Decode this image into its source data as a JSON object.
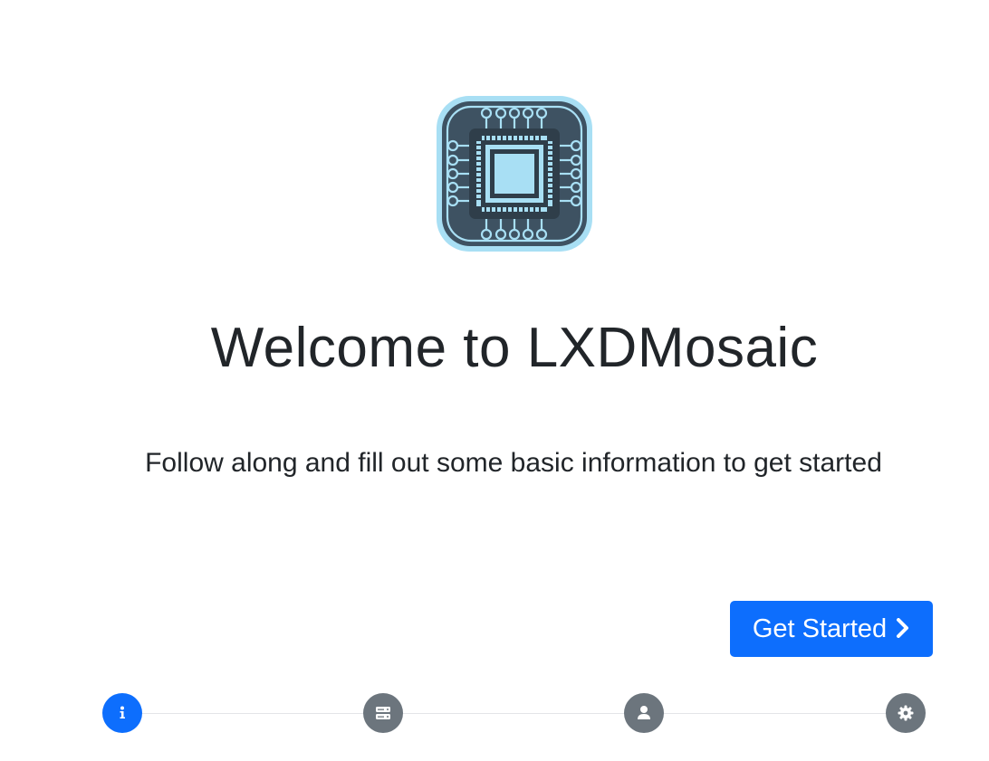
{
  "hero": {
    "logo_icon": "cpu-chip-icon",
    "title": "Welcome to LXDMosaic",
    "subtitle": "Follow along and fill out some basic information to get started"
  },
  "actions": {
    "get_started_label": "Get Started",
    "get_started_icon": "chevron-right-icon"
  },
  "stepper": {
    "current_step": 1,
    "steps": [
      {
        "icon": "info-icon",
        "state": "active"
      },
      {
        "icon": "server-icon",
        "state": "inactive"
      },
      {
        "icon": "user-icon",
        "state": "inactive"
      },
      {
        "icon": "gear-icon",
        "state": "inactive"
      }
    ]
  },
  "colors": {
    "primary": "#0d6efd",
    "inactive": "#6c757d",
    "logo_bg": "#3e5262",
    "logo_accent": "#a8dff4"
  }
}
